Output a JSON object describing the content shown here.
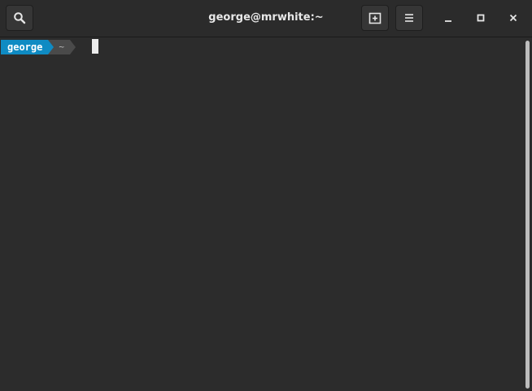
{
  "window": {
    "title": "george@mrwhite:~"
  },
  "headerbar": {
    "search_icon": "search-icon",
    "new_tab_icon": "new-tab-icon",
    "menu_icon": "hamburger-menu-icon",
    "minimize_icon": "minimize-icon",
    "maximize_icon": "maximize-icon",
    "close_icon": "close-icon"
  },
  "terminal": {
    "prompt_user": "george",
    "prompt_dir": "~",
    "colors": {
      "background": "#2c2c2c",
      "user_segment": "#0f8bc3",
      "dir_segment": "#4a4a4a",
      "cursor": "#ececec"
    }
  }
}
